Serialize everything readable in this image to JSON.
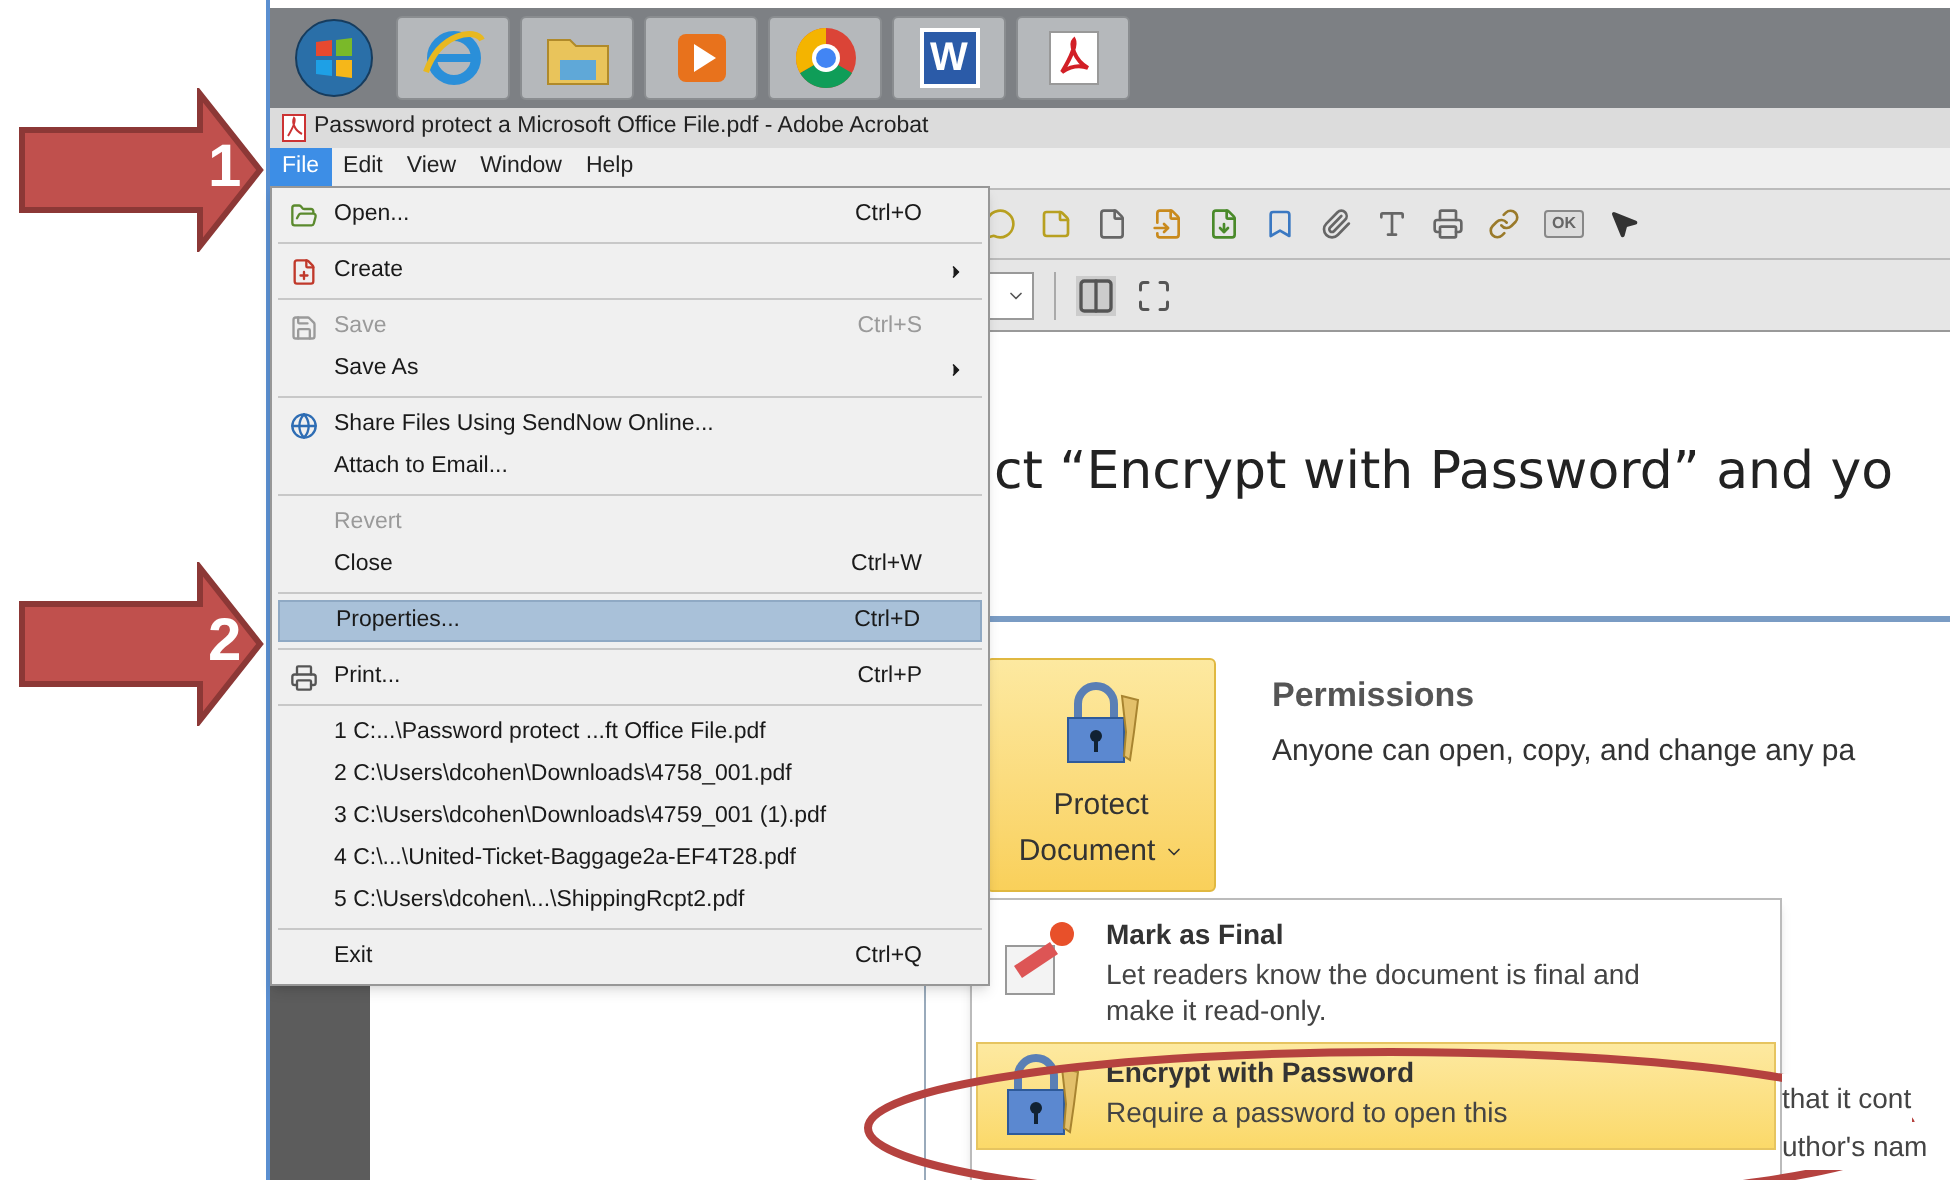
{
  "annotations": [
    {
      "label": "1"
    },
    {
      "label": "2"
    }
  ],
  "taskbar": {
    "word_letter": "W"
  },
  "window": {
    "title": "Password protect a Microsoft Office File.pdf - Adobe Acrobat"
  },
  "menu_bar": [
    {
      "label": "File",
      "selected": true
    },
    {
      "label": "Edit",
      "selected": false
    },
    {
      "label": "View",
      "selected": false
    },
    {
      "label": "Window",
      "selected": false
    },
    {
      "label": "Help",
      "selected": false
    }
  ],
  "toolbar": {
    "ok_label": "OK"
  },
  "file_menu": [
    {
      "kind": "item",
      "label": "Open...",
      "shortcut": "Ctrl+O",
      "submenu": false,
      "disabled": false,
      "selected": false
    },
    {
      "kind": "separator"
    },
    {
      "kind": "item",
      "label": "Create",
      "submenu": true,
      "disabled": false,
      "selected": false
    },
    {
      "kind": "separator"
    },
    {
      "kind": "item",
      "label": "Save",
      "shortcut": "Ctrl+S",
      "submenu": false,
      "disabled": true,
      "selected": false
    },
    {
      "kind": "item",
      "label": "Save As",
      "submenu": true,
      "disabled": false,
      "selected": false
    },
    {
      "kind": "separator"
    },
    {
      "kind": "item",
      "label": "Share Files Using SendNow Online...",
      "submenu": false,
      "disabled": false,
      "selected": false
    },
    {
      "kind": "item",
      "label": "Attach to Email...",
      "submenu": false,
      "disabled": false,
      "selected": false
    },
    {
      "kind": "separator"
    },
    {
      "kind": "item",
      "label": "Revert",
      "submenu": false,
      "disabled": true,
      "selected": false
    },
    {
      "kind": "item",
      "label": "Close",
      "shortcut": "Ctrl+W",
      "submenu": false,
      "disabled": false,
      "selected": false
    },
    {
      "kind": "separator"
    },
    {
      "kind": "item",
      "label": "Properties...",
      "shortcut": "Ctrl+D",
      "submenu": false,
      "disabled": false,
      "selected": true
    },
    {
      "kind": "separator"
    },
    {
      "kind": "item",
      "label": "Print...",
      "shortcut": "Ctrl+P",
      "submenu": false,
      "disabled": false,
      "selected": false
    },
    {
      "kind": "separator"
    },
    {
      "kind": "item",
      "label": "1 C:...\\Password protect ...ft Office File.pdf",
      "submenu": false,
      "disabled": false,
      "selected": false
    },
    {
      "kind": "item",
      "label": "2 C:\\Users\\dcohen\\Downloads\\4758_001.pdf",
      "submenu": false,
      "disabled": false,
      "selected": false
    },
    {
      "kind": "item",
      "label": "3 C:\\Users\\dcohen\\Downloads\\4759_001 (1).pdf",
      "submenu": false,
      "disabled": false,
      "selected": false
    },
    {
      "kind": "item",
      "label": "4 C:\\...\\United-Ticket-Baggage2a-EF4T28.pdf",
      "submenu": false,
      "disabled": false,
      "selected": false
    },
    {
      "kind": "item",
      "label": "5 C:\\Users\\dcohen\\...\\ShippingRcpt2.pdf",
      "submenu": false,
      "disabled": false,
      "selected": false
    },
    {
      "kind": "separator"
    },
    {
      "kind": "item",
      "label": "Exit",
      "shortcut": "Ctrl+Q",
      "submenu": false,
      "disabled": false,
      "selected": false
    }
  ],
  "document": {
    "heading": "ct “Encrypt with Password” and yo",
    "embedded": {
      "protect_button": {
        "line1": "Protect",
        "line2": "Document"
      },
      "permissions": {
        "title": "Permissions",
        "text": "Anyone can open, copy, and change any pa"
      },
      "dropdown": [
        {
          "kind": "final",
          "title": "Mark as Final",
          "description": "Let readers know the document is final and make it read-only.",
          "selected": false
        },
        {
          "kind": "encrypt",
          "title": "Encrypt with Password",
          "description": "Require a password to open this",
          "selected": true
        }
      ],
      "background_text": [
        "that it cont",
        "uthor's nam"
      ]
    }
  }
}
